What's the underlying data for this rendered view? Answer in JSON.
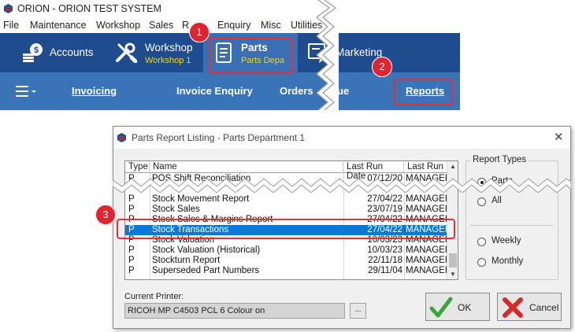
{
  "app": {
    "title": "ORION - ORION TEST SYSTEM",
    "menu": [
      "File",
      "Maintenance",
      "Workshop",
      "Sales",
      "R",
      "Enquiry",
      "Misc",
      "Utilities"
    ],
    "nav": {
      "accounts": "Accounts",
      "workshop": "Workshop",
      "workshop_sub": "Workshop 1",
      "parts": "Parts",
      "parts_sub": "Parts Depa",
      "marketing": "Marketing"
    },
    "subnav": {
      "invoicing": "Invoicing",
      "invoice_enquiry": "Invoice Enquiry",
      "orders": "Orders",
      "que": "que",
      "reports": "Reports"
    }
  },
  "badges": {
    "one": "1",
    "two": "2",
    "three": "3"
  },
  "dialog": {
    "title": "Parts Report Listing - Parts Department 1",
    "close": "✕",
    "columns": {
      "type": "Type",
      "name": "Name",
      "last_run_date": "Last Run Date",
      "last_run": "Last Run"
    },
    "rows": [
      {
        "type": "P",
        "name": "POS Shift Reconciliation",
        "date": "07/12/20",
        "by": "MANAGEF"
      },
      {
        "type": "P",
        "name": "Stock Movement Report",
        "date": "27/04/22",
        "by": "MANAGEF"
      },
      {
        "type": "P",
        "name": "Stock Sales",
        "date": "23/07/19",
        "by": "MANAGEF"
      },
      {
        "type": "P",
        "name": "Stock Sales & Margins Report",
        "date": "27/04/22",
        "by": "MANAGEF"
      },
      {
        "type": "P",
        "name": "Stock Transactions",
        "date": "27/04/22",
        "by": "MANAGEF"
      },
      {
        "type": "P",
        "name": "Stock Valuation",
        "date": "10/03/23",
        "by": "MANAGEF"
      },
      {
        "type": "P",
        "name": "Stock Valuation (Historical)",
        "date": "10/03/23",
        "by": "MANAGEF"
      },
      {
        "type": "P",
        "name": "Stockturn Report",
        "date": "22/11/18",
        "by": "MANAGEF"
      },
      {
        "type": "P",
        "name": "Superseded Part Numbers",
        "date": "29/11/04",
        "by": "MANAGEF"
      }
    ],
    "selected_row": "Stock Transactions",
    "report_types": {
      "title": "Report Types",
      "parts": "Parts",
      "all": "All",
      "weekly": "Weekly",
      "monthly": "Monthly"
    },
    "printer_label": "Current Printer:",
    "printer_value": "RICOH MP C4503 PCL 6 Colour on",
    "dots": "...",
    "ok": "OK",
    "cancel": "Cancel"
  },
  "colors": {
    "nav_dark": "#1f4c8f",
    "nav_light": "#3b73b9",
    "accent_red": "#e0232d",
    "highlight": "#f5d800",
    "selection": "#0a78d7"
  }
}
